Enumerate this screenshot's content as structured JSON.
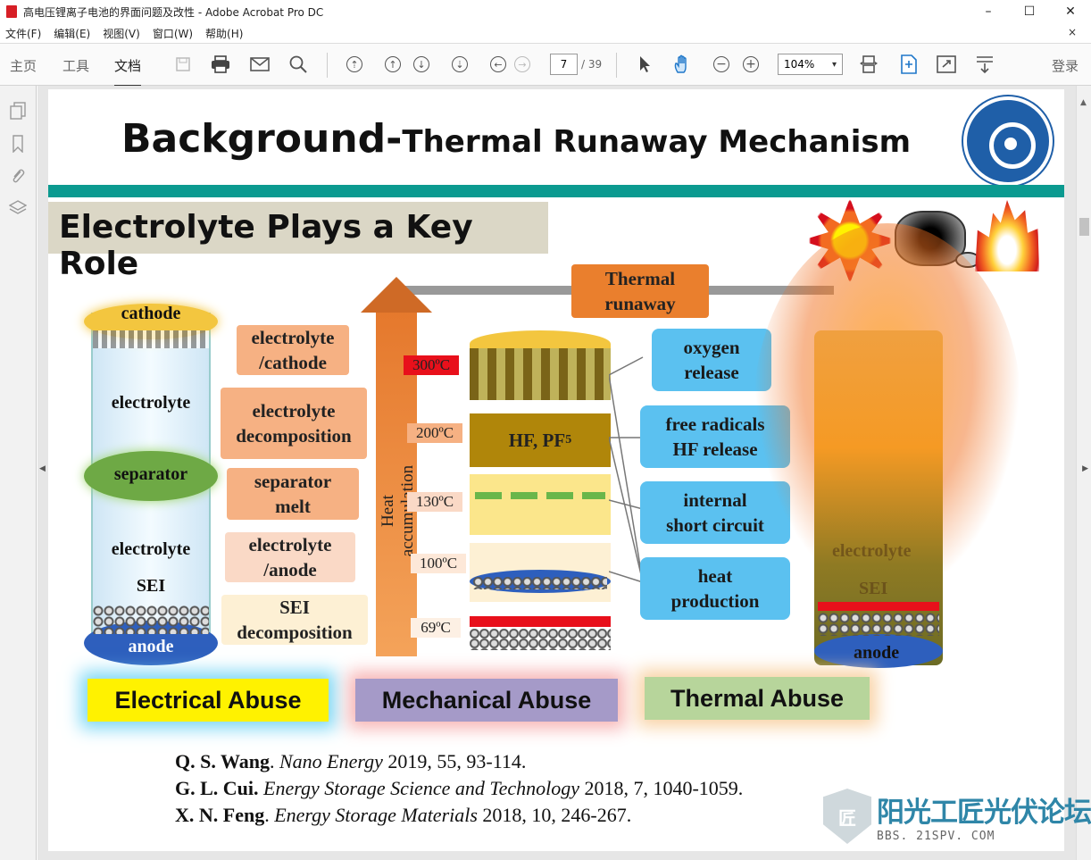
{
  "window": {
    "title": "高电压锂离子电池的界面问题及改性 - Adobe Acrobat Pro DC",
    "minimize": "–",
    "maximize": "☐",
    "close": "✕"
  },
  "menu": {
    "items": [
      "文件(F)",
      "编辑(E)",
      "视图(V)",
      "窗口(W)",
      "帮助(H)"
    ],
    "close_doc": "×"
  },
  "toolbar": {
    "tabs": [
      "主页",
      "工具",
      "文档"
    ],
    "active_tab": "文档",
    "page_current": "7",
    "page_total": "/ 39",
    "zoom": "104%",
    "login": "登录"
  },
  "slide": {
    "title_big": "Background-",
    "title_rest": "Thermal Runaway Mechanism",
    "subtitle": "Electrolyte Plays a Key Role",
    "cylinder": {
      "cathode": "cathode",
      "electrolyte_top": "electrolyte",
      "separator": "separator",
      "electrolyte_bottom": "electrolyte",
      "sei": "SEI",
      "anode": "anode"
    },
    "reactions": [
      {
        "l1": "electrolyte",
        "l2": "/cathode",
        "color": "#f6b183"
      },
      {
        "l1": "electrolyte",
        "l2": "decomposition",
        "color": "#f6b183"
      },
      {
        "l1": "separator",
        "l2": "melt",
        "color": "#f6b183"
      },
      {
        "l1": "electrolyte",
        "l2": "/anode",
        "color": "#fad9c6"
      },
      {
        "l1": "SEI",
        "l2": "decomposition",
        "color": "#fdf0d4"
      }
    ],
    "heat_label": "Heat accumulation",
    "thermal_runaway": {
      "l1": "Thermal",
      "l2": "runaway"
    },
    "temperatures": [
      "300ºC",
      "200ºC",
      "130ºC",
      "100ºC",
      "69ºC"
    ],
    "hf_label": "HF, PF",
    "hf_sub": "5",
    "effects": [
      {
        "l1": "oxygen",
        "l2": "release"
      },
      {
        "l1": "free radicals",
        "l2": "HF release"
      },
      {
        "l1": "internal",
        "l2": "short circuit"
      },
      {
        "l1": "heat",
        "l2": "production"
      }
    ],
    "fire_labels": {
      "electrolyte": "electrolyte",
      "sei": "SEI",
      "anode": "anode"
    },
    "abuse": [
      {
        "label": "Electrical  Abuse",
        "bg": "#fff200",
        "glow": "#3fc4f0"
      },
      {
        "label": "Mechanical Abuse",
        "bg": "#a59ac8",
        "glow": "#f49a9a"
      },
      {
        "label": "Thermal Abuse",
        "bg": "#b7d59b",
        "glow": "#f6c48f"
      }
    ],
    "references": [
      {
        "author": "Q. S. Wang",
        "journal": "Nano Energy",
        "rest": " 2019, 55, 93-114."
      },
      {
        "author": "G. L. Cui.",
        "journal": "Energy Storage Science and Technology",
        "rest": " 2018, 7, 1040-1059."
      },
      {
        "author": "X. N. Feng",
        "journal": "Energy Storage Materials",
        "rest": " 2018, 10, 246-267."
      }
    ]
  },
  "watermark": {
    "badge": "匠",
    "cn": "阳光工匠光伏论坛",
    "url": "BBS. 21SPV. COM"
  }
}
